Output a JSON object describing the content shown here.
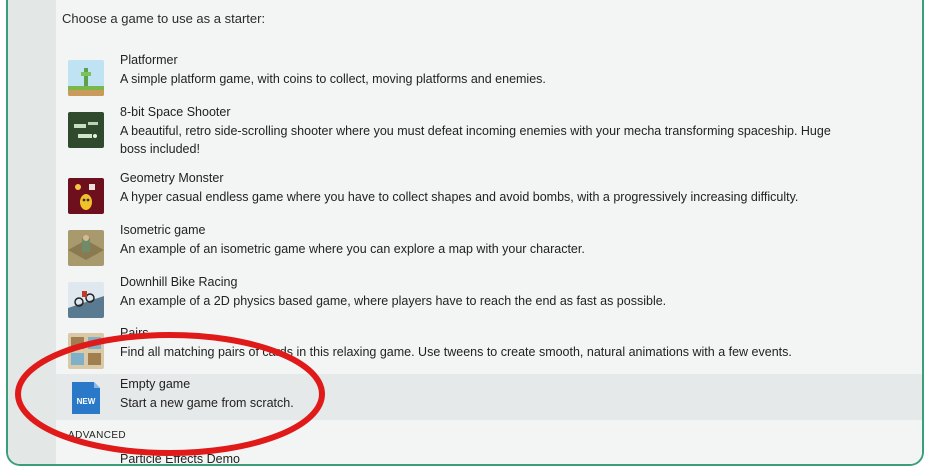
{
  "heading": "Choose a game to use as a starter:",
  "games": [
    {
      "title": "Platformer",
      "description": "A simple platform game, with coins to collect, moving platforms and enemies.",
      "icon": "platformer-thumbnail"
    },
    {
      "title": "8-bit Space Shooter",
      "description": "A beautiful, retro side-scrolling shooter where you must defeat incoming enemies with your mecha transforming spaceship. Huge boss included!",
      "icon": "space-shooter-thumbnail"
    },
    {
      "title": "Geometry Monster",
      "description": "A hyper casual endless game where you have to collect shapes and avoid bombs, with a progressively increasing difficulty.",
      "icon": "geometry-monster-thumbnail"
    },
    {
      "title": "Isometric game",
      "description": "An example of an isometric game where you can explore a map with your character.",
      "icon": "isometric-thumbnail"
    },
    {
      "title": "Downhill Bike Racing",
      "description": "An example of a 2D physics based game, where players have to reach the end as fast as possible.",
      "icon": "bike-racing-thumbnail"
    },
    {
      "title": "Pairs",
      "description": "Find all matching pairs of cards in this relaxing game. Use tweens to create smooth, natural animations with a few events.",
      "icon": "pairs-thumbnail"
    },
    {
      "title": "Empty game",
      "description": "Start a new game from scratch.",
      "icon": "new-game-icon",
      "badge": "NEW"
    }
  ],
  "section_label": "ADVANCED",
  "next_item_partial": "Particle Effects Demo",
  "colors": {
    "frame_border": "#3a9e78",
    "highlight_ring": "#e01919",
    "new_badge": "#1f6fbf"
  }
}
